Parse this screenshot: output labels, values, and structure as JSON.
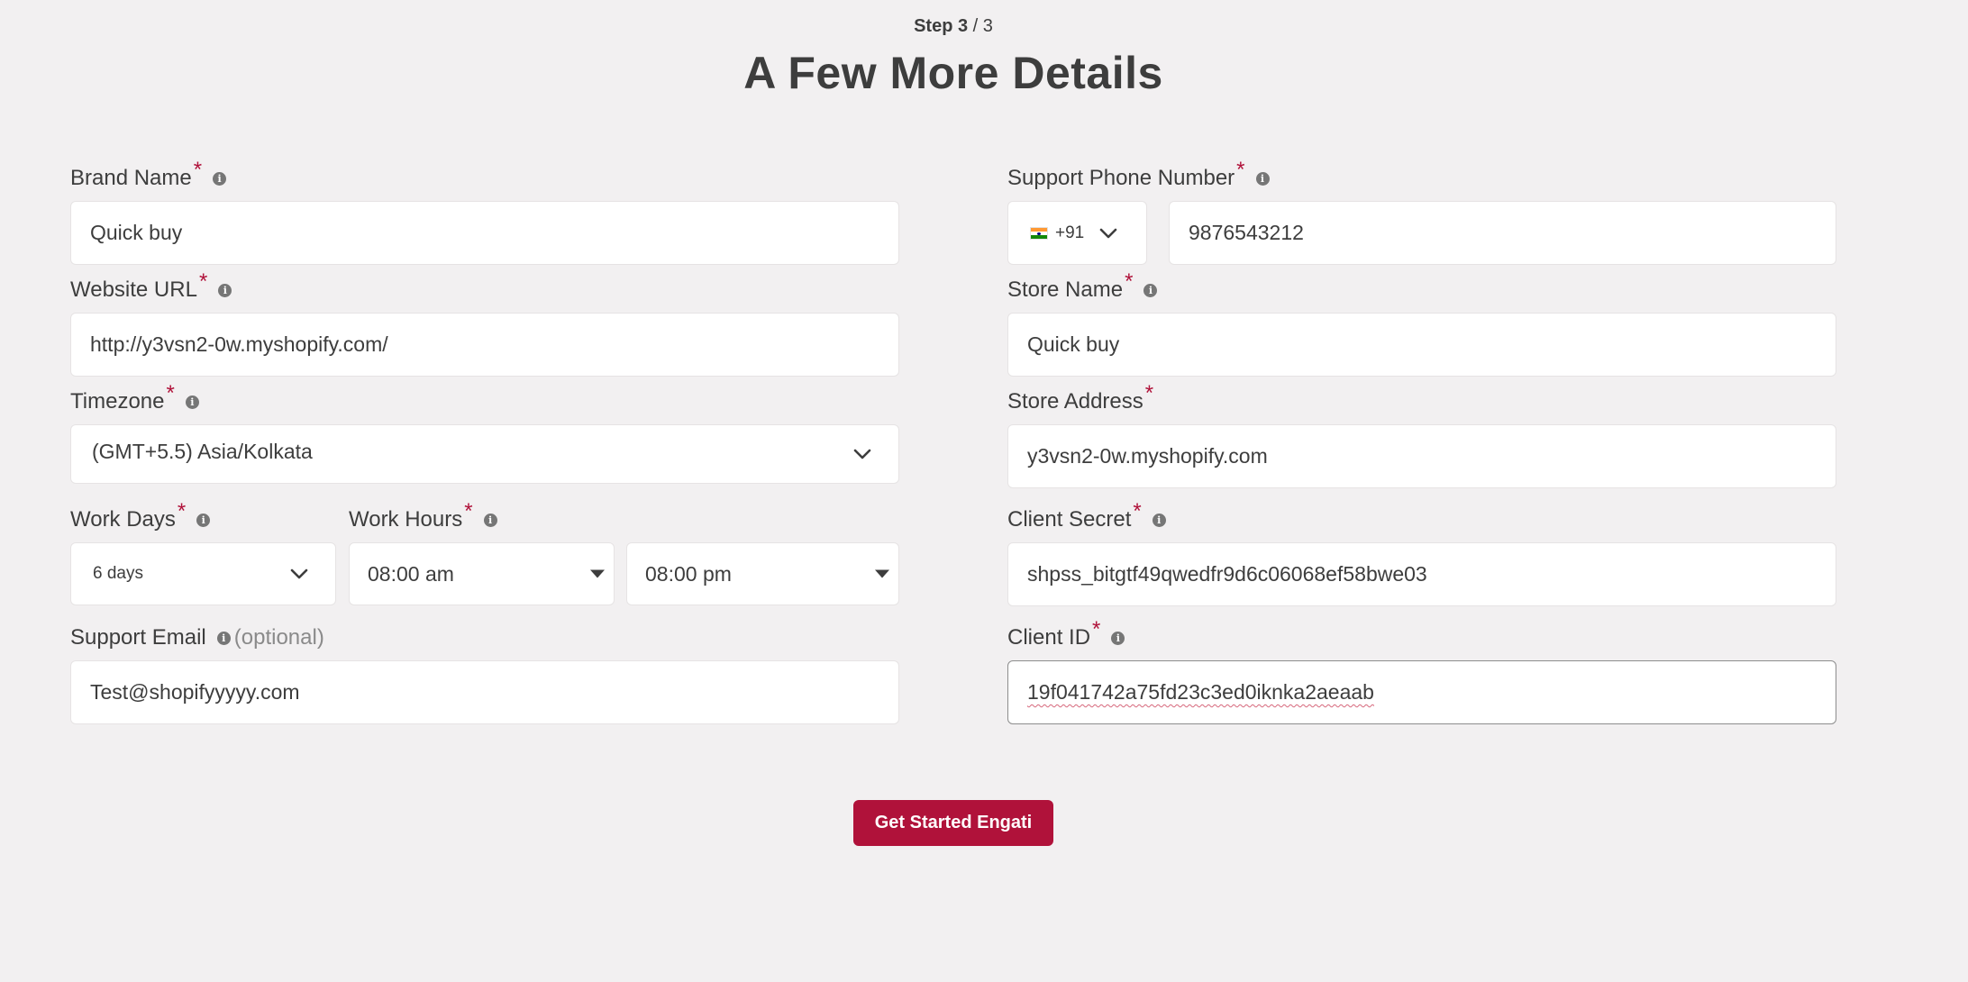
{
  "header": {
    "step_current": "Step 3",
    "step_total": "/ 3",
    "title": "A Few More Details"
  },
  "form": {
    "required_mark": "*",
    "info_glyph": "i",
    "brand_name": {
      "label": "Brand Name",
      "value": "Quick buy"
    },
    "website_url": {
      "label": "Website URL",
      "value": "http://y3vsn2-0w.myshopify.com/"
    },
    "timezone": {
      "label": "Timezone",
      "value": "(GMT+5.5) Asia/Kolkata"
    },
    "work_days": {
      "label": "Work Days",
      "value": "6 days"
    },
    "work_hours": {
      "label": "Work Hours",
      "start": "08:00 am",
      "end": "08:00 pm"
    },
    "support_email": {
      "label": "Support Email",
      "optional": "(optional)",
      "value": "Test@shopifyyyyy.com"
    },
    "support_phone": {
      "label": "Support Phone Number",
      "country_code": "+91",
      "value": "9876543212"
    },
    "store_name": {
      "label": "Store Name",
      "value": "Quick buy"
    },
    "store_address": {
      "label": "Store Address",
      "value": "y3vsn2-0w.myshopify.com"
    },
    "client_secret": {
      "label": "Client Secret",
      "value": "shpss_bitgtf49qwedfr9d6c06068ef58bwe03"
    },
    "client_id": {
      "label": "Client ID",
      "value": "19f041742a75fd23c3ed0iknka2aeaab"
    }
  },
  "submit": {
    "label": "Get Started Engati"
  },
  "colors": {
    "accent": "#b0123a",
    "background": "#f2f0f1",
    "text": "#3d3d3d",
    "field_bg": "#ffffff"
  },
  "icons": {
    "info": "info-icon",
    "dropdown": "chevron-down-icon",
    "select_caret": "caret-down-icon",
    "flag": "india-flag-icon"
  }
}
